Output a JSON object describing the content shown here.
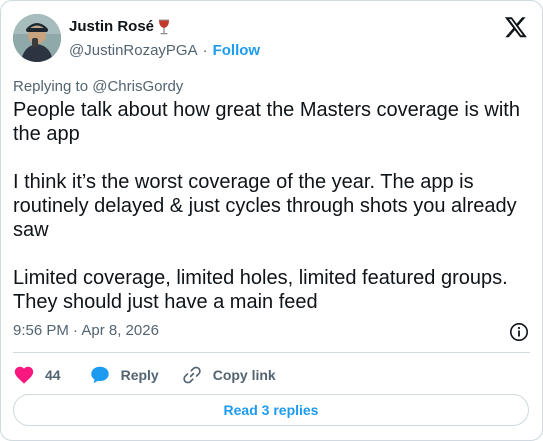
{
  "author": {
    "name": "Justin Rosé",
    "handle": "@JustinRozayPGA",
    "separator": "·",
    "follow_label": "Follow"
  },
  "reply_context": {
    "prefix": "Replying to ",
    "mention": "@ChrisGordy"
  },
  "tweet": {
    "text": "People talk about how great the Masters coverage is with the app\n\nI think it’s the worst coverage of the year. The app is routinely delayed & just cycles through shots you already saw\n\nLimited coverage, limited holes, limited featured groups. They should just have a main feed",
    "timestamp": "9:56 PM · Apr 8, 2026"
  },
  "actions": {
    "like_count": "44",
    "reply_label": "Reply",
    "copy_link_label": "Copy link"
  },
  "read_replies_label": "Read 3 replies",
  "icons": {
    "wine": "wine-glass-emoji",
    "x_logo": "x-logo",
    "info": "info-icon",
    "like": "heart-icon",
    "reply": "speech-bubble-icon",
    "copy_link": "link-icon"
  },
  "colors": {
    "accent": "#1d9bf0",
    "like": "#f91880",
    "muted": "#536471",
    "text": "#0f1419",
    "border": "#cfd9de"
  }
}
